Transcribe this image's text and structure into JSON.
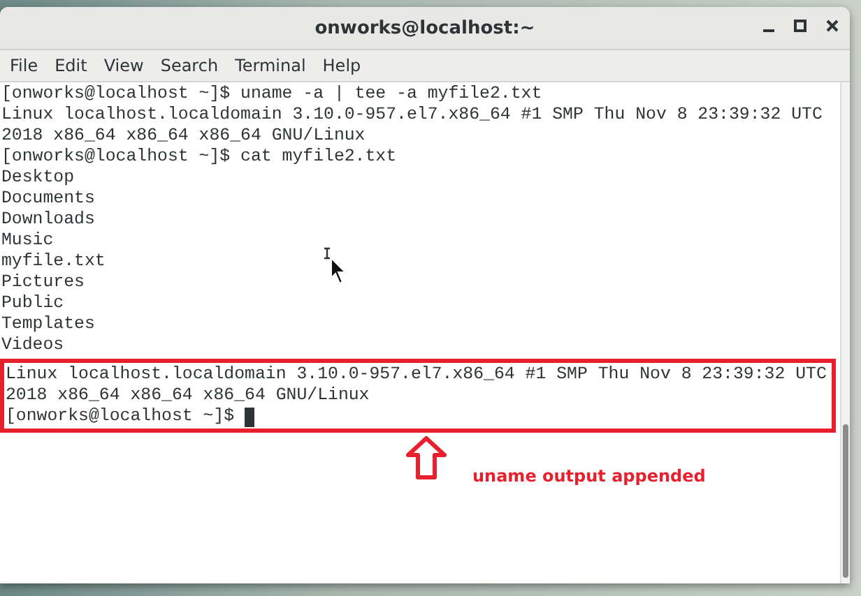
{
  "window": {
    "title": "onworks@localhost:~"
  },
  "menu": [
    "File",
    "Edit",
    "View",
    "Search",
    "Terminal",
    "Help"
  ],
  "terminal": {
    "lines": [
      "[onworks@localhost ~]$ uname -a | tee -a myfile2.txt",
      "Linux localhost.localdomain 3.10.0-957.el7.x86_64 #1 SMP Thu Nov 8 23:39:32 UTC",
      "2018 x86_64 x86_64 x86_64 GNU/Linux",
      "[onworks@localhost ~]$ cat myfile2.txt",
      "Desktop",
      "Documents",
      "Downloads",
      "Music",
      "myfile.txt",
      "Pictures",
      "Public",
      "Templates",
      "Videos"
    ],
    "highlighted_lines": [
      "Linux localhost.localdomain 3.10.0-957.el7.x86_64 #1 SMP Thu Nov 8 23:39:32 UTC",
      "2018 x86_64 x86_64 x86_64 GNU/Linux"
    ],
    "prompt": "[onworks@localhost ~]$"
  },
  "annotation": {
    "label": "uname output appended"
  }
}
